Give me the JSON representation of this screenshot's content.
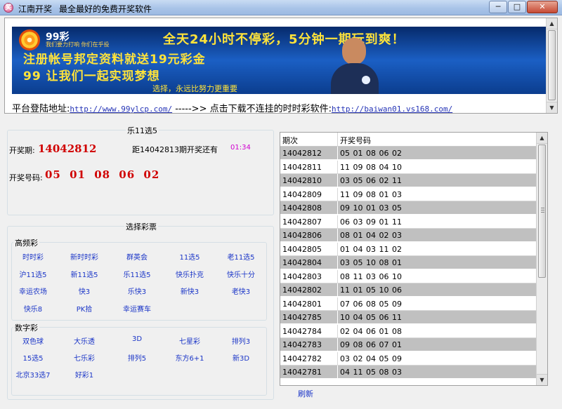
{
  "window": {
    "icon_glyph": "奖",
    "title": "江南开奖",
    "subtitle": "最全最好的免费开奖软件",
    "btn_min": "─",
    "btn_max": "□",
    "btn_close": "✕"
  },
  "banner": {
    "brand": "99彩",
    "brand_sub": "我们要力打响 你们在乎投",
    "line1": "全天24小时不停彩，5分钟一期玩到爽！",
    "line2": "注册帐号邦定资料就送19元彩金",
    "line3": "99 让我们一起实现梦想",
    "line4": "选择，永远比努力更重要"
  },
  "links": {
    "label1": "平台登陆地址:",
    "url1": "http://www.99ylcp.com/",
    "arrow": " ----->> ",
    "label2": "点击下载不连挂的时时彩软件:",
    "url2": "http://baiwan01.vs168.com/"
  },
  "draw": {
    "legend": "乐11选5",
    "issue_label": "开奖期:",
    "issue": "14042812",
    "next_label": "距14042813期开奖还有",
    "countdown": "01:34",
    "numbers_label": "开奖号码:",
    "numbers": "05 01 08 06 02"
  },
  "select": {
    "legend": "选择彩票",
    "high_freq_label": "高频彩",
    "high_freq": [
      "时时彩",
      "新时时彩",
      "群英会",
      "11选5",
      "老11选5",
      "沪11选5",
      "新11选5",
      "乐11选5",
      "快乐扑克",
      "快乐十分",
      "幸运农场",
      "快3",
      "乐快3",
      "新快3",
      "老快3",
      "快乐8",
      "PK拾",
      "幸运赛车"
    ],
    "digit_label": "数字彩",
    "digit": [
      "双色球",
      "大乐透",
      "3D",
      "七星彩",
      "排列3",
      "15选5",
      "七乐彩",
      "排列5",
      "东方6+1",
      "新3D",
      "北京33选7",
      "好彩1"
    ]
  },
  "table": {
    "col1": "期次",
    "col2": "开奖号码",
    "rows": [
      {
        "issue": "14042812",
        "nums": "05 01 08 06 02"
      },
      {
        "issue": "14042811",
        "nums": "11 09 08 04 10"
      },
      {
        "issue": "14042810",
        "nums": "03 05 06 02 11"
      },
      {
        "issue": "14042809",
        "nums": "11 09 08 01 03"
      },
      {
        "issue": "14042808",
        "nums": "09 10 01 03 05"
      },
      {
        "issue": "14042807",
        "nums": "06 03 09 01 11"
      },
      {
        "issue": "14042806",
        "nums": "08 01 04 02 03"
      },
      {
        "issue": "14042805",
        "nums": "01 04 03 11 02"
      },
      {
        "issue": "14042804",
        "nums": "03 05 10 08 01"
      },
      {
        "issue": "14042803",
        "nums": "08 11 03 06 10"
      },
      {
        "issue": "14042802",
        "nums": "11 01 05 10 06"
      },
      {
        "issue": "14042801",
        "nums": "07 06 08 05 09"
      },
      {
        "issue": "14042785",
        "nums": "10 04 05 06 11"
      },
      {
        "issue": "14042784",
        "nums": "02 04 06 01 08"
      },
      {
        "issue": "14042783",
        "nums": "09 08 06 07 01"
      },
      {
        "issue": "14042782",
        "nums": "03 02 04 05 09"
      },
      {
        "issue": "14042781",
        "nums": "04 11 05 08 03"
      }
    ]
  },
  "refresh_label": "刷新"
}
